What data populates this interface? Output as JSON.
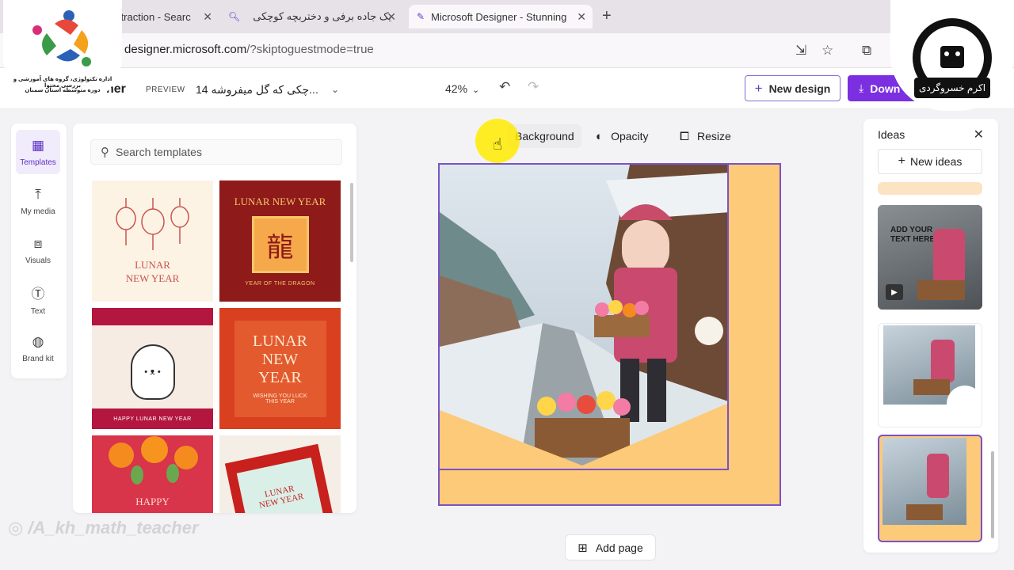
{
  "browser": {
    "tabs": [
      {
        "label": "st attraction - Searc",
        "active": false
      },
      {
        "label": "یک جاده برفی و دختربچه کوچکی",
        "active": false
      },
      {
        "label": "Microsoft Designer - Stunning",
        "active": true
      }
    ],
    "url_domain": "designer.microsoft.com",
    "url_rest": "/?skiptoguestmode=true"
  },
  "header": {
    "brand": "ner",
    "preview": "PREVIEW",
    "doc_name": "چکی که گل میفروشه 14...",
    "zoom": "42%",
    "new_design": "New design",
    "download": "Down"
  },
  "rail": [
    {
      "label": "Templates",
      "icon": "grid-icon",
      "active": true
    },
    {
      "label": "My media",
      "icon": "upload-icon",
      "active": false
    },
    {
      "label": "Visuals",
      "icon": "shapes-icon",
      "active": false
    },
    {
      "label": "Text",
      "icon": "text-icon",
      "active": false
    },
    {
      "label": "Brand kit",
      "icon": "palette-icon",
      "active": false
    }
  ],
  "templates": {
    "search_placeholder": "Search templates",
    "cards": [
      {
        "title": "LUNAR NEW YEAR",
        "subtitle": "",
        "bg": "#fdf3e4",
        "fg": "#c8544e"
      },
      {
        "title": "LUNAR NEW YEAR",
        "subtitle": "YEAR OF THE DRAGON",
        "bg": "#8e1a1a",
        "fg": "#f6c66b"
      },
      {
        "title": "HAPPY LUNAR NEW YEAR",
        "subtitle": "",
        "bg": "#b3163e",
        "fg": "#ffffff"
      },
      {
        "title": "LUNAR NEW YEAR",
        "subtitle": "WISHING YOU LUCK THIS YEAR",
        "bg": "#d8401f",
        "fg": "#ffe8cf"
      },
      {
        "title": "HAPPY",
        "subtitle": "",
        "bg": "#d8344a",
        "fg": "#ffd8c8"
      },
      {
        "title": "LUNAR NEW YEAR",
        "subtitle": "",
        "bg": "#c8201c",
        "fg": "#ffffff"
      }
    ]
  },
  "canvas_toolbar": {
    "background": "Background",
    "opacity": "Opacity",
    "resize": "Resize"
  },
  "add_page": "Add page",
  "ideas": {
    "title": "Ideas",
    "new_ideas": "New ideas",
    "card1_text": "ADD YOUR TEXT HERE"
  },
  "overlays": {
    "left_logo_line1": "اداره تکنولوژی، گروه های آموزشی و بررسی محتوا",
    "left_logo_line2": "دوره متوسطه استان سمنان",
    "right_logo_name": "اکرم خسروگردی",
    "watermark": "/A_kh_math_teacher"
  },
  "colors": {
    "accent": "#7b2fe0",
    "canvas_bg": "#fcca78",
    "selection": "#7b52c7"
  }
}
